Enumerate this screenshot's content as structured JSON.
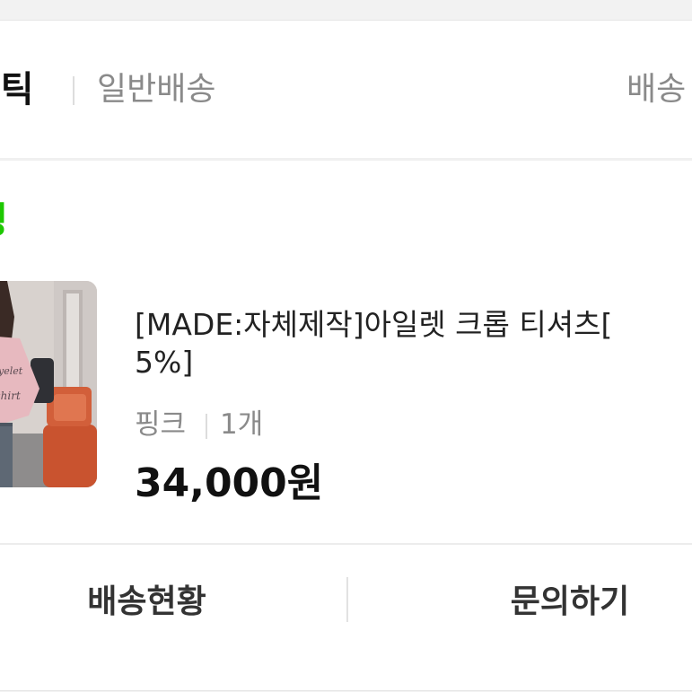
{
  "store": {
    "name_visible": "티틱",
    "shipping_type": "일반배송",
    "shipping_link": "배송"
  },
  "order": {
    "status": "정"
  },
  "product": {
    "title_line1": "[MADE:자체제작]아일렛 크롭 티셔츠[",
    "title_line2": "5%]",
    "option_color": "핑크",
    "option_qty": "1개",
    "price": "34,000원",
    "thumbnail_text": "T-shirt"
  },
  "actions": {
    "track_label": "배송현황",
    "inquiry_label": "문의하기"
  },
  "colors": {
    "status_green": "#1ec800",
    "text_dark": "#111111",
    "text_gray": "#8a8a8a"
  }
}
